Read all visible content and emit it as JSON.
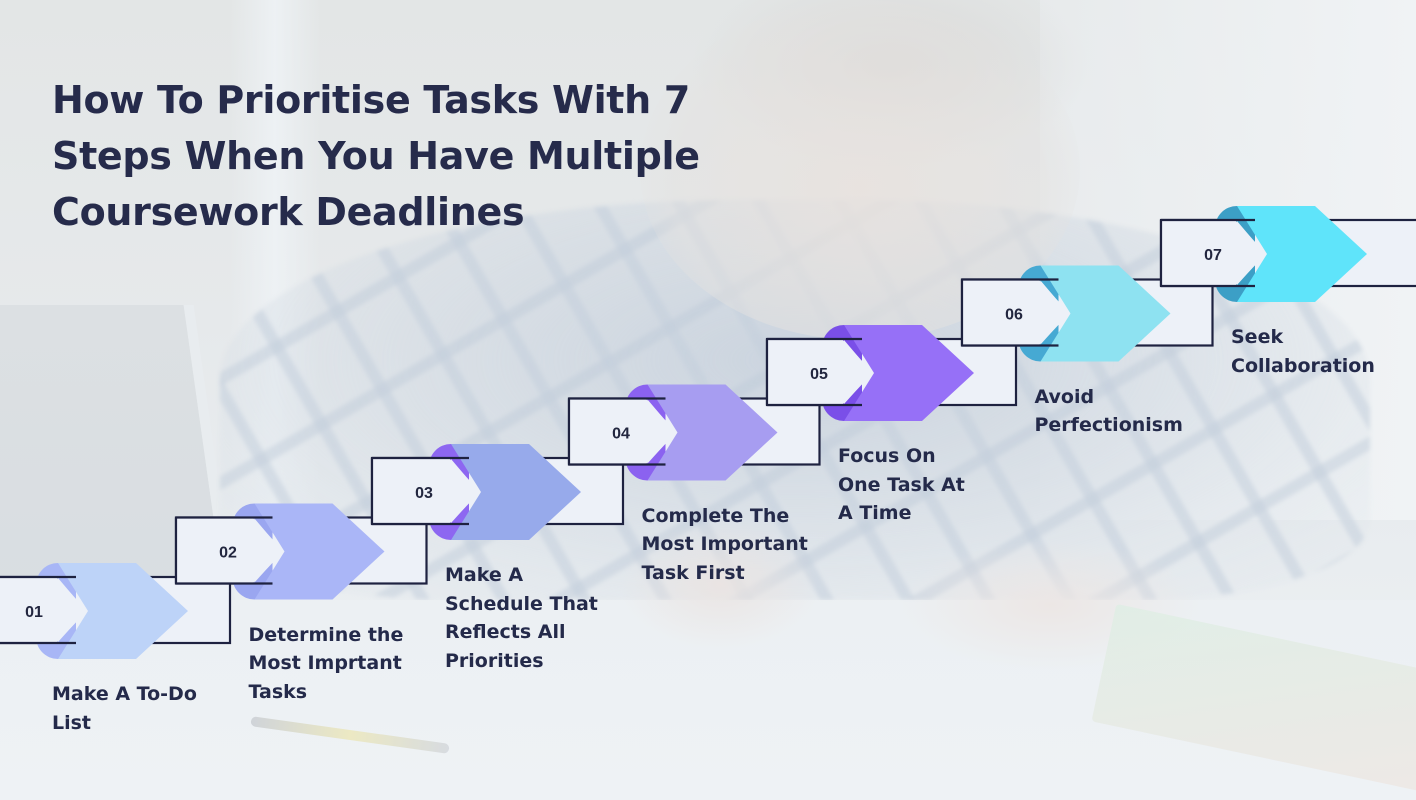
{
  "title": "How To Prioritise Tasks With 7 Steps When You Have Multiple Coursework Deadlines",
  "title_lines": [
    "How To Prioritise Tasks With 7",
    "Steps When You Have Multiple",
    "Coursework Deadlines"
  ],
  "colors": {
    "title_text": "#262b4b",
    "label_text": "#242a4a",
    "box_fill": "#edf1f8",
    "box_border": "#1e2240"
  },
  "steps": [
    {
      "number": "01",
      "label_lines": [
        "Make A To-Do",
        "List"
      ],
      "chevron_color": "#bdd3f8",
      "cap_color": "#a8b6f6"
    },
    {
      "number": "02",
      "label_lines": [
        "Determine the",
        "Most Imprtant",
        "Tasks"
      ],
      "chevron_color": "#aab6f7",
      "cap_color": "#9aa6f0"
    },
    {
      "number": "03",
      "label_lines": [
        "Make A",
        "Schedule That",
        "Reflects All",
        "Priorities"
      ],
      "chevron_color": "#97aaeb",
      "cap_color": "#8d67f1"
    },
    {
      "number": "04",
      "label_lines": [
        "Complete The",
        "Most Important",
        "Task First"
      ],
      "chevron_color": "#a79df1",
      "cap_color": "#8b62f0"
    },
    {
      "number": "05",
      "label_lines": [
        "Focus On",
        "One Task At",
        "A Time"
      ],
      "chevron_color": "#9670f7",
      "cap_color": "#7a4fe8"
    },
    {
      "number": "06",
      "label_lines": [
        "Avoid",
        "Perfectionism"
      ],
      "chevron_color": "#8ee2f1",
      "cap_color": "#46a9d3"
    },
    {
      "number": "07",
      "label_lines": [
        "Seek",
        "Collaboration"
      ],
      "chevron_color": "#5fe4fa",
      "cap_color": "#3c9fc6"
    }
  ]
}
